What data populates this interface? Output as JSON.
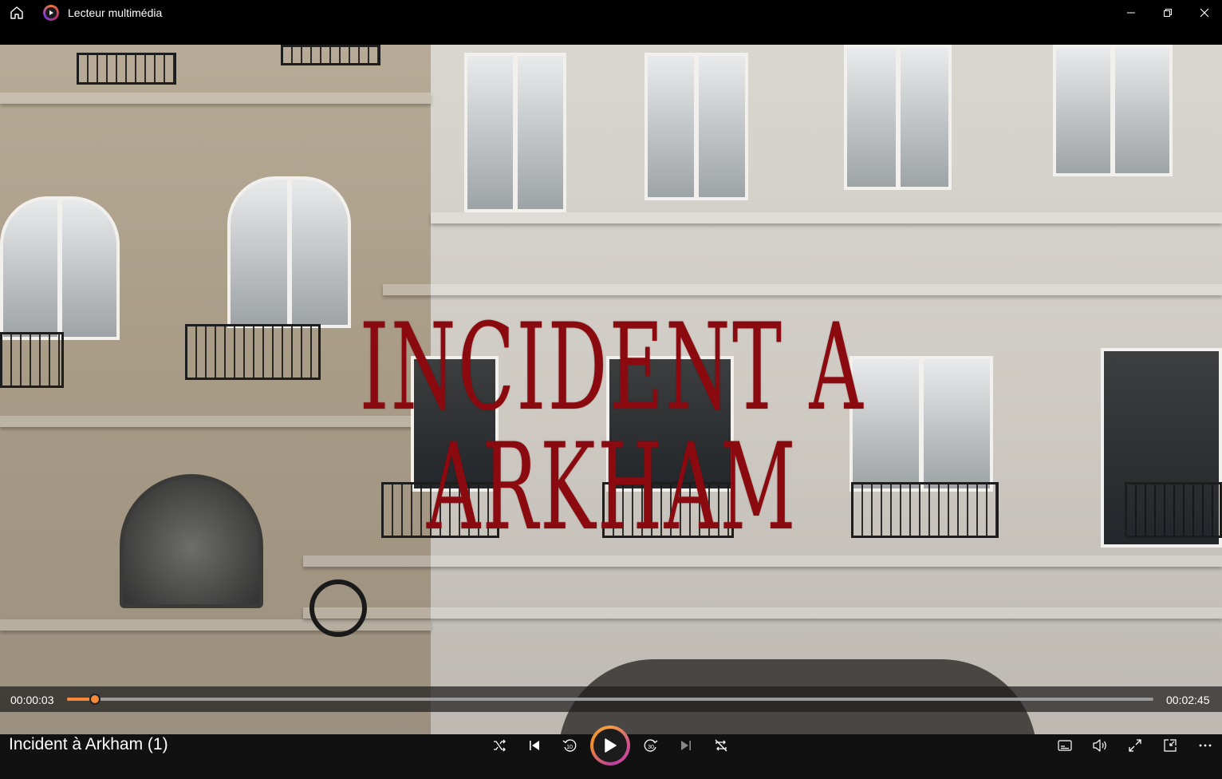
{
  "window": {
    "app_title": "Lecteur multimédia"
  },
  "video": {
    "overlay_title": "INCIDENT A ARKHAM"
  },
  "seekbar": {
    "current_time": "00:00:03",
    "total_time": "00:02:45",
    "progress_fraction": 0.026
  },
  "now_playing": {
    "title": "Incident à Arkham (1)"
  },
  "controls": {
    "skip_back_seconds": "10",
    "skip_forward_seconds": "30"
  },
  "colors": {
    "accent": "#f7893b",
    "title_red": "#8b0a10"
  }
}
